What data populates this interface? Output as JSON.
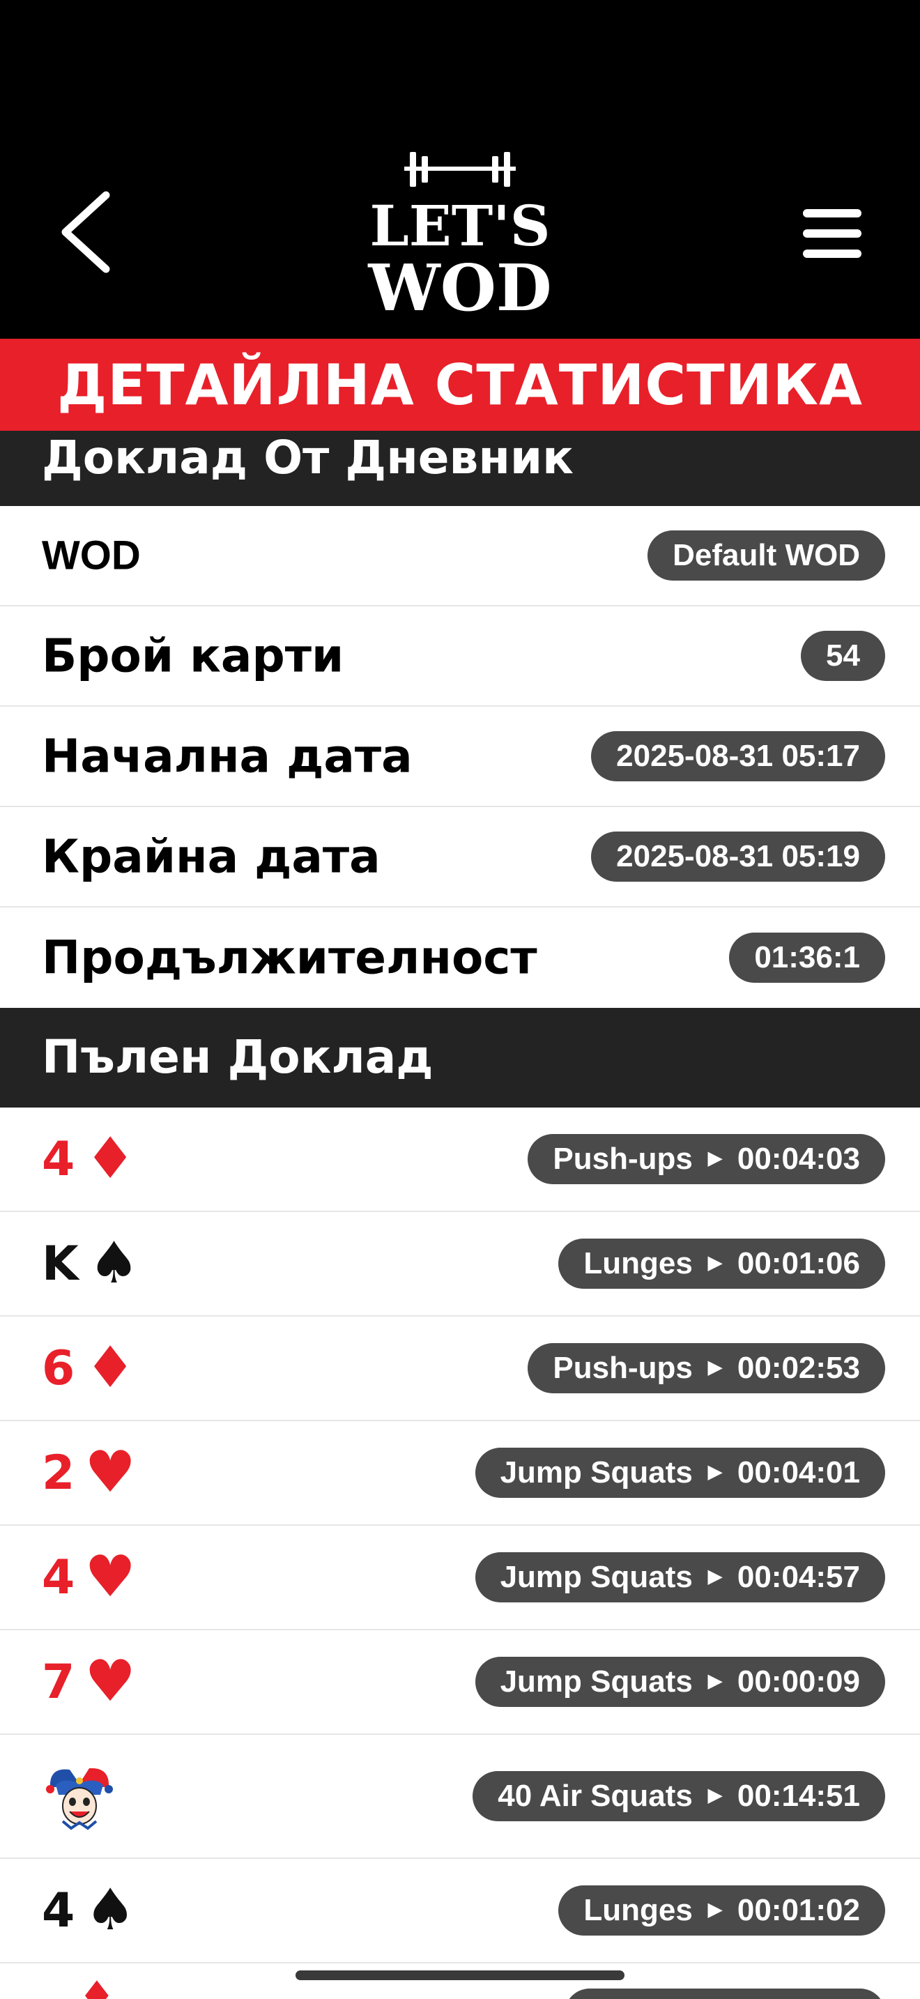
{
  "header": {
    "logo_text_top": "LET'S",
    "logo_text_bottom": "WOD",
    "back_icon": "chevron-left-icon",
    "menu_icon": "hamburger-menu-icon"
  },
  "banner": {
    "title": "ДЕТАЙЛНА СТАТИСТИКА"
  },
  "summary": {
    "title": "Доклад От Дневник",
    "rows": [
      {
        "label": "WOD",
        "value": "Default WOD"
      },
      {
        "label": "Брой карти",
        "value": "54"
      },
      {
        "label": "Начална дата",
        "value": "2025-08-31 05:17"
      },
      {
        "label": "Крайна дата",
        "value": "2025-08-31 05:19"
      },
      {
        "label": "Продължителност",
        "value": "01:36:1"
      }
    ]
  },
  "full_report": {
    "title": "Пълен Доклад",
    "arrow": "▶",
    "rows": [
      {
        "rank": "4",
        "suit": "♦",
        "color": "red",
        "exercise": "Push-ups",
        "time": "00:04:03"
      },
      {
        "rank": "K",
        "suit": "♠",
        "color": "black",
        "exercise": "Lunges",
        "time": "00:01:06"
      },
      {
        "rank": "6",
        "suit": "♦",
        "color": "red",
        "exercise": "Push-ups",
        "time": "00:02:53"
      },
      {
        "rank": "2",
        "suit": "♥",
        "color": "red",
        "exercise": "Jump Squats",
        "time": "00:04:01"
      },
      {
        "rank": "4",
        "suit": "♥",
        "color": "red",
        "exercise": "Jump Squats",
        "time": "00:04:57"
      },
      {
        "rank": "7",
        "suit": "♥",
        "color": "red",
        "exercise": "Jump Squats",
        "time": "00:00:09"
      },
      {
        "rank": "",
        "suit": "",
        "color": "joker",
        "exercise": "40 Air Squats",
        "time": "00:14:51"
      },
      {
        "rank": "4",
        "suit": "♠",
        "color": "black",
        "exercise": "Lunges",
        "time": "00:01:02"
      }
    ]
  },
  "colors": {
    "accent_red": "#e8202a",
    "header_dark": "#232323",
    "pill_bg": "#4a4a4a"
  }
}
